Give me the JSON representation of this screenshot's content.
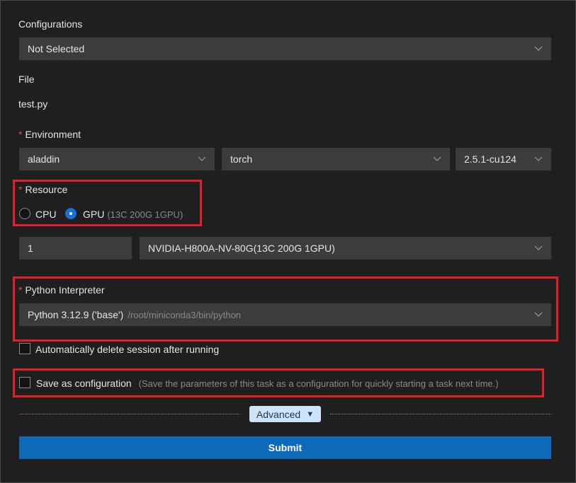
{
  "configurations": {
    "label": "Configurations",
    "selected": "Not Selected"
  },
  "file": {
    "label": "File",
    "value": "test.py"
  },
  "environment": {
    "required_mark": "*",
    "label": "Environment",
    "name": "aladdin",
    "framework": "torch",
    "version": "2.5.1-cu124"
  },
  "resource": {
    "required_mark": "*",
    "label": "Resource",
    "options": [
      "CPU",
      "GPU"
    ],
    "selected": "GPU",
    "gpu_hint": "(13C 200G 1GPU)",
    "count": "1",
    "instance": "NVIDIA-H800A-NV-80G(13C 200G 1GPU)"
  },
  "python": {
    "required_mark": "*",
    "label": "Python Interpreter",
    "selected": "Python 3.12.9 ('base')",
    "path": "/root/miniconda3/bin/python"
  },
  "auto_delete": {
    "label": "Automatically delete session after running",
    "checked": false
  },
  "save_config": {
    "label": "Save as configuration",
    "hint": "(Save the parameters of this task as a configuration for quickly starting a task next time.)",
    "checked": false
  },
  "advanced": {
    "label": "Advanced",
    "icon": "caret-down-icon"
  },
  "submit": {
    "label": "Submit"
  },
  "colors": {
    "background": "#1f1f1f",
    "field": "#3c3c3c",
    "accent": "#0e6ab8",
    "highlight": "#e3202a",
    "required": "#e04a4a"
  }
}
